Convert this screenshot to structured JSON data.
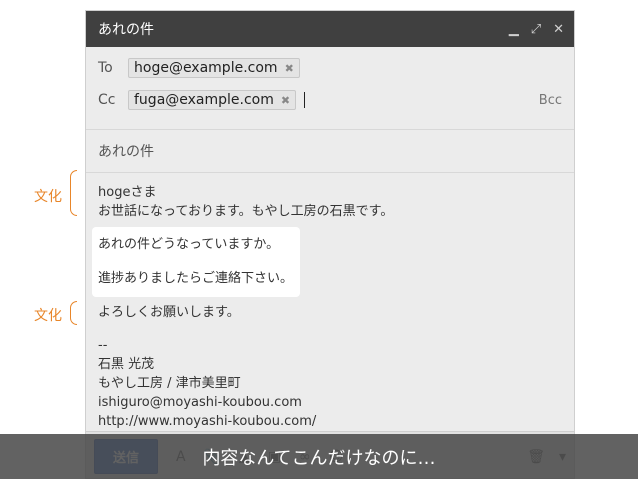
{
  "window": {
    "title": "あれの件",
    "minimize_icon": "minimize-icon",
    "expand_icon": "expand-icon",
    "close_icon": "close-icon"
  },
  "to": {
    "label": "To",
    "recipient": "hoge@example.com"
  },
  "cc": {
    "label": "Cc",
    "recipient": "fuga@example.com",
    "bcc_label": "Bcc"
  },
  "subject": "あれの件",
  "body": {
    "line1": "hogeさま",
    "line2": "お世話になっております。もやし工房の石黒です。",
    "highlight_line1": "あれの件どうなっていますか。",
    "highlight_line2": "進捗ありましたらご連絡下さい。",
    "line3": "よろしくお願いします。",
    "sig_dash": "--",
    "sig_name": "石黒 光茂",
    "sig_org": "もやし工房 / 津市美里町",
    "sig_email": "ishiguro@moyashi-koubou.com",
    "sig_url": "http://www.moyashi-koubou.com/"
  },
  "toolbar": {
    "send_label": "送信"
  },
  "annotations": {
    "top": "文化",
    "bottom": "文化",
    "color": "#e8862a"
  },
  "caption": "内容なんてこんだけなのに…"
}
